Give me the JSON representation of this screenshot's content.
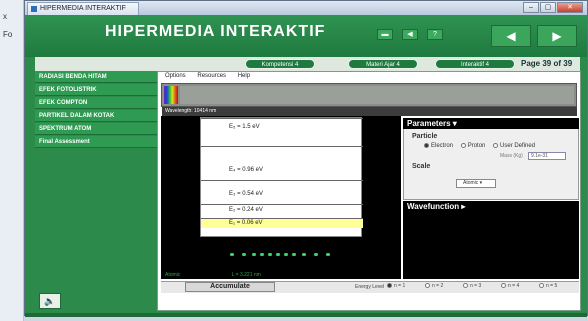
{
  "desktop": {
    "left_labels": [
      "x",
      "Fo"
    ]
  },
  "window": {
    "title": "HIPERMEDIA INTERAKTIF",
    "buttons": {
      "minimize": "–",
      "maximize": "▢",
      "close": "✕"
    }
  },
  "app": {
    "title": "HIPERMEDIA INTERAKTIF",
    "header_buttons": [
      "▬",
      "◀",
      "?"
    ],
    "nav_prev": "◀",
    "nav_next": "▶",
    "pills": [
      "Kompetensi 4",
      "Materi Ajar 4",
      "Interaktif 4"
    ],
    "page_label": "Page 39 of 39"
  },
  "sidebar": {
    "items": [
      {
        "label": "RADIASI BENDA HITAM"
      },
      {
        "label": "EFEK FOTOLISTRIK"
      },
      {
        "label": "EFEK COMPTON"
      },
      {
        "label": "PARTIKEL DALAM KOTAK"
      },
      {
        "label": "SPEKTRUM ATOM"
      },
      {
        "label": "Final Assessment"
      }
    ],
    "speaker_icon": "speaker-icon"
  },
  "simulation": {
    "menu": [
      "Options",
      "Resources",
      "Help"
    ],
    "wavelength_label": "Wavelength: 10414 nm",
    "energy_levels": [
      {
        "label": "E₅ = 1.5 eV"
      },
      {
        "label": "E₄ = 0.96 eV"
      },
      {
        "label": "E₃ = 0.54 eV"
      },
      {
        "label": "E₂ = 0.24 eV"
      },
      {
        "label": "E₁ = 0.06 eV"
      }
    ],
    "status_left": "Atomic",
    "status_mid": "L = 3.221 nm",
    "parameters": {
      "title": "Parameters ▾",
      "particle_label": "Particle",
      "particle_options": [
        "Electron",
        "Proton",
        "User Defined"
      ],
      "mass_label": "Mass (Kg)",
      "mass_value": "9.1e-31",
      "scale_label": "Scale",
      "scale_value": "Atomic"
    },
    "wavefunction_title": "Wavefunction ▸",
    "accumulate_label": "Accumulate",
    "energy_level_label": "Energy Level",
    "n_options": [
      "n = 1",
      "n = 2",
      "n = 3",
      "n = 4",
      "n = 5"
    ]
  }
}
